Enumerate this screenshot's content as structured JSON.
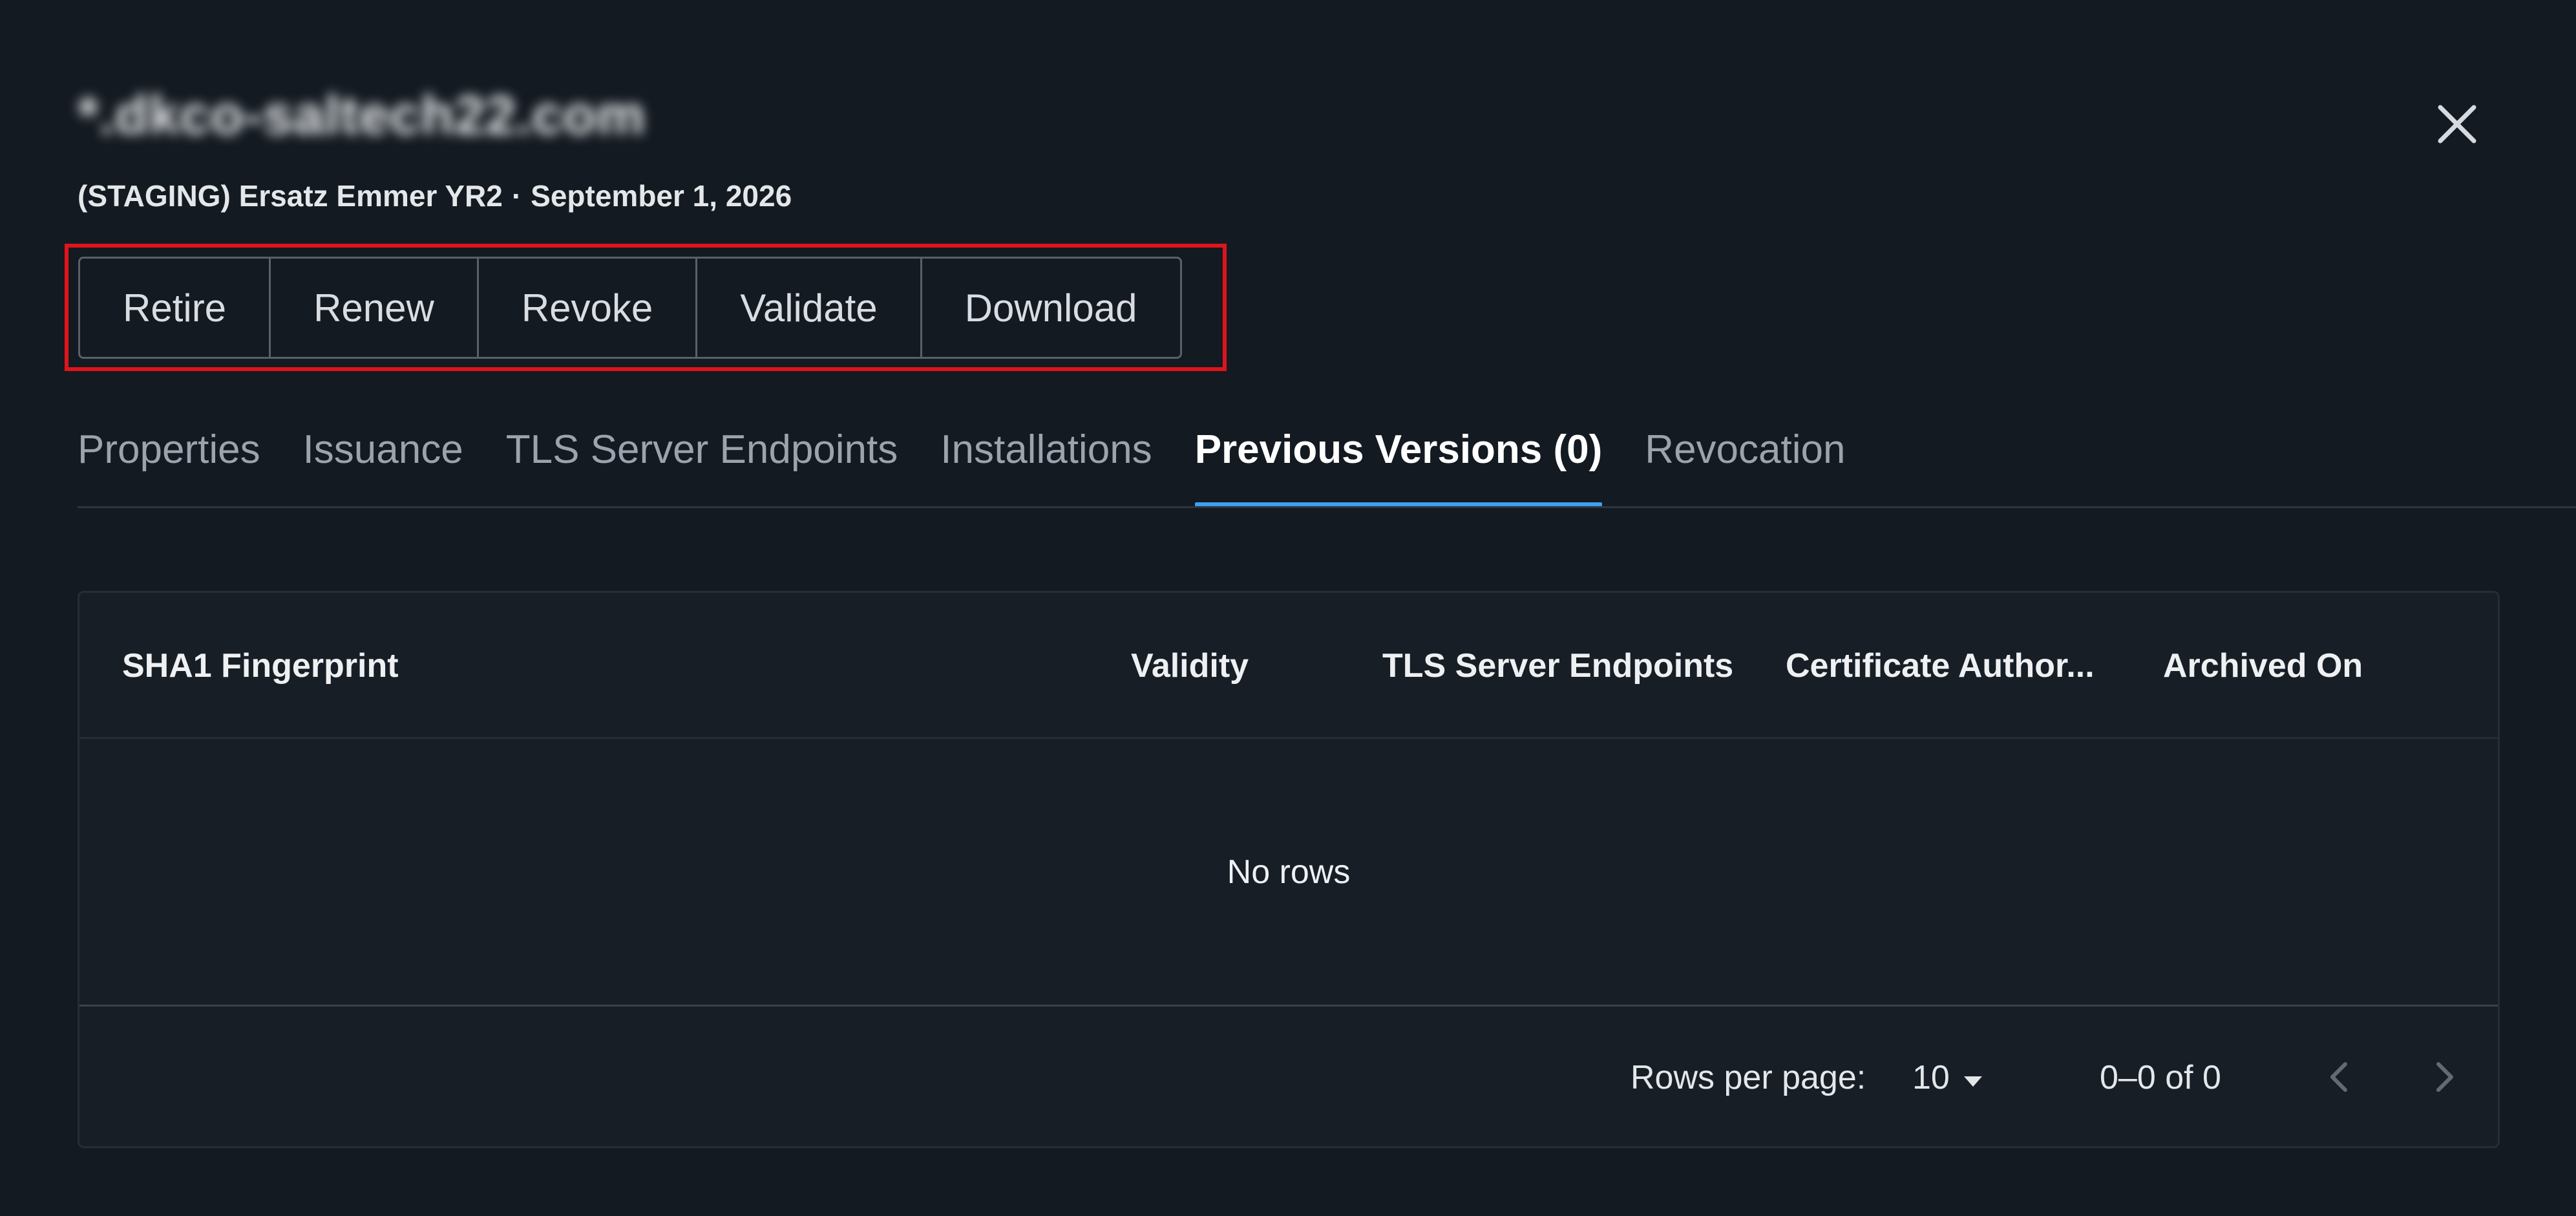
{
  "header": {
    "title": "*.dkco-saltech22.com",
    "issuer": "(STAGING) Ersatz Emmer YR2",
    "separator": "·",
    "expiry": "September 1, 2026",
    "close_icon": "close-icon"
  },
  "actions": [
    {
      "label": "Retire"
    },
    {
      "label": "Renew"
    },
    {
      "label": "Revoke"
    },
    {
      "label": "Validate"
    },
    {
      "label": "Download"
    }
  ],
  "tabs": [
    {
      "label": "Properties"
    },
    {
      "label": "Issuance"
    },
    {
      "label": "TLS Server Endpoints"
    },
    {
      "label": "Installations"
    },
    {
      "label": "Previous Versions (0)",
      "active": true
    },
    {
      "label": "Revocation"
    }
  ],
  "table": {
    "columns": [
      {
        "label": "SHA1 Fingerprint"
      },
      {
        "label": "Validity"
      },
      {
        "label": "TLS Server Endpoints"
      },
      {
        "label": "Certificate Author..."
      },
      {
        "label": "Archived On"
      }
    ],
    "empty_text": "No rows"
  },
  "pagination": {
    "rows_per_page_label": "Rows per page:",
    "rows_per_page_value": "10",
    "range_text": "0–0 of 0",
    "prev_icon": "chevron-left-icon",
    "next_icon": "chevron-right-icon"
  },
  "colors": {
    "background": "#141a21",
    "active_tab_indicator": "#3fa0f0",
    "highlight_box": "#e0141b"
  }
}
